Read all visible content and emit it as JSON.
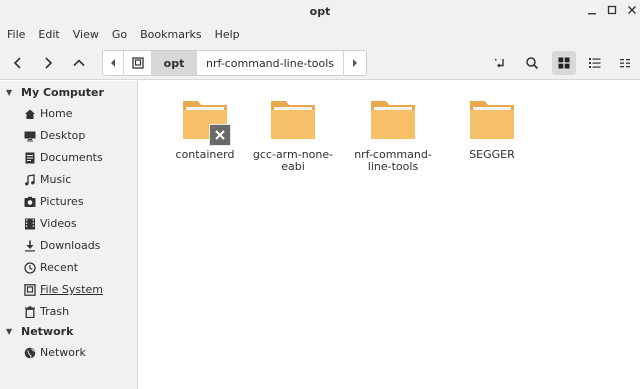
{
  "window": {
    "title": "opt"
  },
  "menu": [
    "File",
    "Edit",
    "View",
    "Go",
    "Bookmarks",
    "Help"
  ],
  "toolbar": {
    "icons": [
      "back-icon",
      "forward-icon",
      "up-icon",
      "open-terminal-icon",
      "search-icon",
      "icon-view-icon",
      "list-view-icon",
      "compact-view-icon"
    ],
    "path": {
      "current": "opt",
      "next": "nrf-command-line-tools"
    }
  },
  "sidebar": {
    "sections": [
      {
        "title": "My Computer",
        "items": [
          {
            "label": "Home",
            "icon": "home-icon"
          },
          {
            "label": "Desktop",
            "icon": "desktop-icon"
          },
          {
            "label": "Documents",
            "icon": "documents-icon"
          },
          {
            "label": "Music",
            "icon": "music-icon"
          },
          {
            "label": "Pictures",
            "icon": "pictures-icon"
          },
          {
            "label": "Videos",
            "icon": "videos-icon"
          },
          {
            "label": "Downloads",
            "icon": "downloads-icon"
          },
          {
            "label": "Recent",
            "icon": "recent-icon"
          },
          {
            "label": "File System",
            "icon": "drive-icon"
          },
          {
            "label": "Trash",
            "icon": "trash-icon"
          }
        ]
      },
      {
        "title": "Network",
        "items": [
          {
            "label": "Network",
            "icon": "network-icon"
          }
        ]
      }
    ]
  },
  "files": [
    {
      "name": "containerd",
      "badge": "no-access"
    },
    {
      "name": "gcc-arm-none-eabi"
    },
    {
      "name": "nrf-command-line-tools"
    },
    {
      "name": "SEGGER"
    }
  ],
  "colors": {
    "folder": "#f6c068",
    "folder_tab": "#e9a94e",
    "sidebar_bg": "#f1f1f1",
    "selected_bg": "#d8d8d8"
  }
}
